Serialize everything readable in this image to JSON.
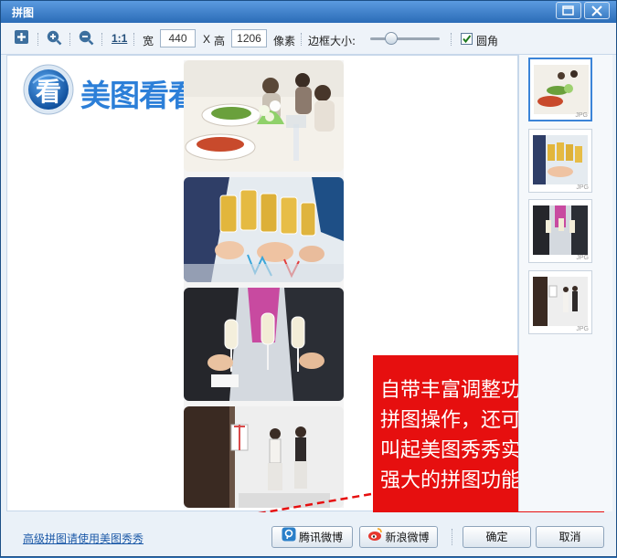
{
  "window": {
    "title": "拼图"
  },
  "toolbar": {
    "zoom_ratio": "1:1",
    "width_label": "宽",
    "width_value": "440",
    "x_label": "X",
    "height_label": "高",
    "height_value": "1206",
    "unit_label": "像素",
    "border_label": "边框大小:",
    "border_level": 0.3,
    "rounded_label": "圆角",
    "rounded_checked": true
  },
  "watermark": {
    "logo_text": "美图看看",
    "logo_glyph": "看"
  },
  "thumbnails": [
    {
      "format": "JPG",
      "selected": true
    },
    {
      "format": "JPG",
      "selected": false
    },
    {
      "format": "JPG",
      "selected": false
    },
    {
      "format": "JPG",
      "selected": false
    }
  ],
  "callout": {
    "lines": [
      "自带丰富调整功能的",
      "拼图操作，还可快速",
      "叫起美图秀秀实现更",
      "强大的拼图功能"
    ]
  },
  "footer": {
    "advanced_link": "高级拼图请使用美图秀秀",
    "tencent_label": "腾讯微博",
    "sina_label": "新浪微博",
    "ok_label": "确定",
    "cancel_label": "取消"
  },
  "colors": {
    "accent": "#2b6cb7",
    "callout": "#e60f0f",
    "arrow": "#e60f0f"
  }
}
